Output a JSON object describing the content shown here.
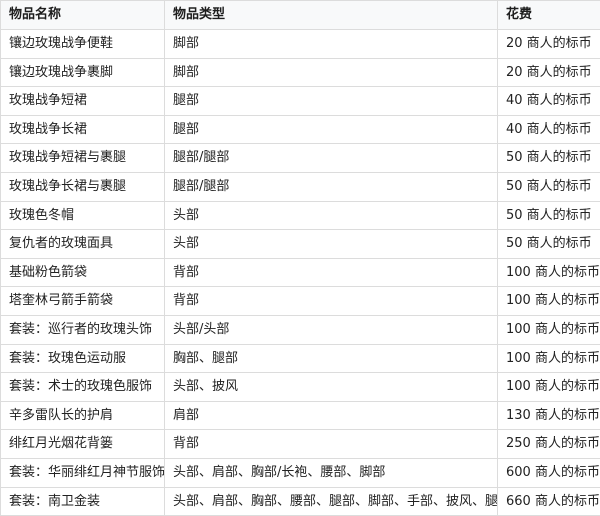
{
  "table": {
    "headers": [
      "物品名称",
      "物品类型",
      "花费"
    ],
    "rows": [
      [
        "镶边玫瑰战争便鞋",
        "脚部",
        "20 商人的标币"
      ],
      [
        "镶边玫瑰战争裹脚",
        "脚部",
        "20 商人的标币"
      ],
      [
        "玫瑰战争短裙",
        "腿部",
        "40 商人的标币"
      ],
      [
        "玫瑰战争长裙",
        "腿部",
        "40 商人的标币"
      ],
      [
        "玫瑰战争短裙与裹腿",
        "腿部/腿部",
        "50 商人的标币"
      ],
      [
        "玫瑰战争长裙与裹腿",
        "腿部/腿部",
        "50 商人的标币"
      ],
      [
        "玫瑰色冬帽",
        "头部",
        "50 商人的标币"
      ],
      [
        "复仇者的玫瑰面具",
        "头部",
        "50 商人的标币"
      ],
      [
        "基础粉色箭袋",
        "背部",
        "100 商人的标币"
      ],
      [
        "塔奎林弓箭手箭袋",
        "背部",
        "100 商人的标币"
      ],
      [
        "套装：巡行者的玫瑰头饰",
        "头部/头部",
        "100 商人的标币"
      ],
      [
        "套装：玫瑰色运动服",
        "胸部、腿部",
        "100 商人的标币"
      ],
      [
        "套装：术士的玫瑰色服饰",
        "头部、披风",
        "100 商人的标币"
      ],
      [
        "辛多雷队长的护肩",
        "肩部",
        "130 商人的标币"
      ],
      [
        "绯红月光烟花背篓",
        "背部",
        "250 商人的标币"
      ],
      [
        "套装：华丽绯红月神节服饰",
        "头部、肩部、胸部/长袍、腰部、脚部",
        "600 商人的标币"
      ],
      [
        "套装：南卫金装",
        "头部、肩部、胸部、腰部、腿部、脚部、手部、披风、腿部",
        "660 商人的标币"
      ]
    ]
  }
}
